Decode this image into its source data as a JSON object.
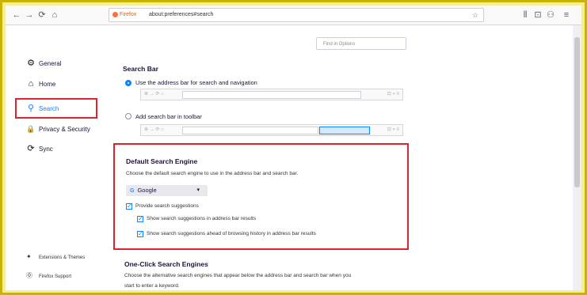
{
  "toolbar": {
    "back": "←",
    "forward": "→",
    "reload": "⟳",
    "home": "⌂",
    "url_brand": "Firefox",
    "url": "about:preferences#search",
    "star": "☆",
    "right_icons": [
      "⫴",
      "⊡",
      "⚇",
      "≡"
    ]
  },
  "find": {
    "placeholder": "Find in Options"
  },
  "sidebar": {
    "items": [
      {
        "label": "General",
        "icon": "⚙"
      },
      {
        "label": "Home",
        "icon": "⌂"
      },
      {
        "label": "Search",
        "icon": "⚲"
      },
      {
        "label": "Privacy & Security",
        "icon": "🔒"
      },
      {
        "label": "Sync",
        "icon": "⟳"
      }
    ],
    "footer": [
      {
        "label": "Extensions & Themes",
        "icon": "✦"
      },
      {
        "label": "Firefox Support",
        "icon": "⓪"
      }
    ]
  },
  "search_bar": {
    "heading": "Search Bar",
    "option1": "Use the address bar for search and navigation",
    "option2": "Add search bar in toolbar"
  },
  "default_engine": {
    "heading": "Default Search Engine",
    "description": "Choose the default search engine to use in the address bar and search bar.",
    "engine": "Google",
    "provide": "Provide search suggestions",
    "show_address": "Show search suggestions in address bar results",
    "show_ahead": "Show search suggestions ahead of browsing history in address bar results"
  },
  "one_click": {
    "heading": "One-Click Search Engines",
    "description": "Choose the alternative search engines that appear below the address bar and search bar when you",
    "description2": "start to enter a keyword."
  },
  "colors": {
    "accent": "#0a84ff",
    "highlight": "#e0222c",
    "frame": "#c8b400"
  }
}
